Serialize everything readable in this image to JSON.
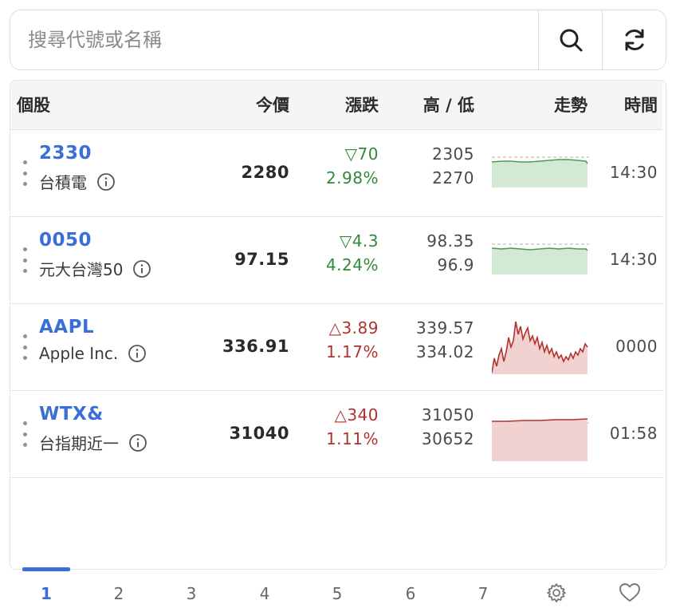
{
  "search": {
    "placeholder": "搜尋代號或名稱",
    "value": ""
  },
  "icons": {
    "search": "search-icon",
    "refresh": "refresh-icon",
    "drag": "drag-handle-icon",
    "info": "info-icon",
    "settings": "gear-icon",
    "favorites": "heart-icon"
  },
  "table": {
    "headers": {
      "stock": "個股",
      "price": "今價",
      "change": "漲跌",
      "high_low": "高 / 低",
      "trend": "走勢",
      "time": "時間"
    },
    "rows": [
      {
        "code": "2330",
        "name": "台積電",
        "price": "2280",
        "change": "▽70",
        "change_pct": "2.98%",
        "direction": "down",
        "high": "2305",
        "low": "2270",
        "time": "14:30"
      },
      {
        "code": "0050",
        "name": "元大台灣50",
        "price": "97.15",
        "change": "▽4.3",
        "change_pct": "4.24%",
        "direction": "down",
        "high": "98.35",
        "low": "96.9",
        "time": "14:30"
      },
      {
        "code": "AAPL",
        "name": "Apple Inc.",
        "price": "336.91",
        "change": "△3.89",
        "change_pct": "1.17%",
        "direction": "up",
        "high": "339.57",
        "low": "334.02",
        "time": "0000"
      },
      {
        "code": "WTX&",
        "name": "台指期近一",
        "price": "31040",
        "change": "△340",
        "change_pct": "1.11%",
        "direction": "up",
        "high": "31050",
        "low": "30652",
        "time": "01:58"
      }
    ]
  },
  "pager": {
    "pages": [
      "1",
      "2",
      "3",
      "4",
      "5",
      "6",
      "7"
    ],
    "active": "1"
  },
  "colors": {
    "accent": "#3b6fd8",
    "down": "#2f8a3a",
    "down_fill": "#d4e9d4",
    "up": "#b0332e",
    "up_fill": "#f2d2d0",
    "header_bg": "#f3f5f7"
  }
}
